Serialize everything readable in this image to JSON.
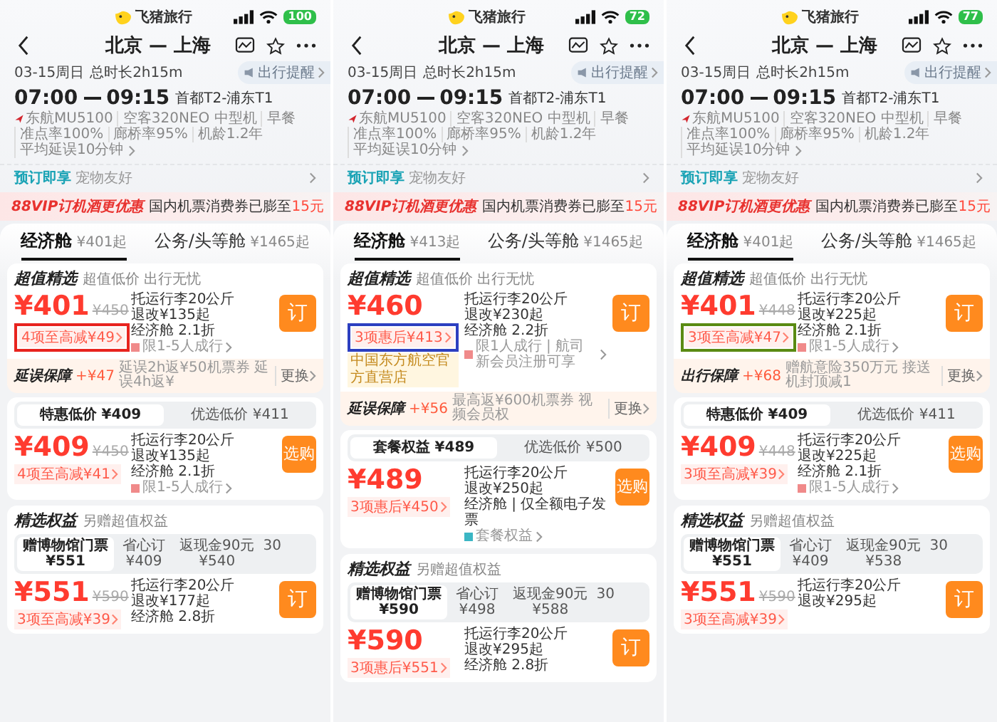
{
  "phones": [
    {
      "status": {
        "app": "飞猪旅行",
        "battery": "100"
      },
      "nav": {
        "title": "北京 — 上海"
      },
      "flight": {
        "date": "03-15周日",
        "duration": "总时长2h15m",
        "reminder": "出行提醒",
        "depart": "07:00",
        "arrive": "09:15",
        "airports": "首都T2-浦东T1",
        "specs": [
          "东航MU5100",
          "空客320NEO 中型机",
          "早餐",
          "准点率100%",
          "廊桥率95%",
          "机龄1.2年",
          "平均延误10分钟"
        ]
      },
      "perk": {
        "label": "预订即享",
        "text": "宠物友好"
      },
      "banner": {
        "highlight": "88VIP订机酒更优惠",
        "text": "国内机票消费券已膨至",
        "amount": "15元"
      },
      "cabins": [
        {
          "label": "经济舱",
          "price": "¥401起",
          "selected": true
        },
        {
          "label": "公务/头等舱",
          "price": "¥1465起",
          "selected": false
        }
      ],
      "offers": [
        {
          "title": "超值精选",
          "subtitle": "超值低价 出行无忧",
          "price": "¥401",
          "old_price": "¥450",
          "discount": "4项至高减¥49",
          "frame": {
            "color": "#e8231e"
          },
          "details": [
            "托运行李20公斤",
            "退改¥135起",
            "经济舱 2.1折"
          ],
          "limit": {
            "text": "限1-5人成行",
            "color": "#f08a8a"
          },
          "button": "订",
          "addon": {
            "title": "延误保障",
            "price": "+¥47",
            "text": "延误2h返¥50机票券 延误4h返¥",
            "action": "更换"
          }
        },
        {
          "options": [
            {
              "label": "特惠低价 ¥409",
              "selected": true
            },
            {
              "label": "优选低价 ¥411",
              "selected": false
            }
          ],
          "price": "¥409",
          "old_price": "¥450",
          "discount": "4项至高减¥41",
          "details": [
            "托运行李20公斤",
            "退改¥135起",
            "经济舱 2.1折"
          ],
          "limit": {
            "text": "限1-5人成行",
            "color": "#f08a8a"
          },
          "button": "选购"
        },
        {
          "title": "精选权益",
          "subtitle": "另赠超值权益",
          "options": [
            {
              "label": "赠博物馆门票",
              "price": "¥551",
              "selected": true
            },
            {
              "label": "省心订",
              "price": "¥409",
              "selected": false
            },
            {
              "label": "返现金90元",
              "price": "¥540",
              "selected": false
            },
            {
              "label": "30",
              "selected": false
            }
          ],
          "price": "¥551",
          "old_price": "¥590",
          "discount": "3项至高减¥39",
          "details": [
            "托运行李20公斤",
            "退改¥177起",
            "经济舱 2.8折"
          ],
          "button": "订"
        }
      ]
    },
    {
      "status": {
        "app": "飞猪旅行",
        "battery": "72"
      },
      "nav": {
        "title": "北京 — 上海"
      },
      "flight": {
        "date": "03-15周日",
        "duration": "总时长2h15m",
        "reminder": "出行提醒",
        "depart": "07:00",
        "arrive": "09:15",
        "airports": "首都T2-浦东T1",
        "specs": [
          "东航MU5100",
          "空客320NEO 中型机",
          "早餐",
          "准点率100%",
          "廊桥率95%",
          "机龄1.2年",
          "平均延误10分钟"
        ]
      },
      "perk": {
        "label": "预订即享",
        "text": "宠物友好"
      },
      "banner": {
        "highlight": "88VIP订机酒更优惠",
        "text": "国内机票消费券已膨至",
        "amount": "15元"
      },
      "cabins": [
        {
          "label": "经济舱",
          "price": "¥413起",
          "selected": true
        },
        {
          "label": "公务/头等舱",
          "price": "¥1465起",
          "selected": false
        }
      ],
      "offers": [
        {
          "title": "超值精选",
          "subtitle": "超值低价 出行无忧",
          "price": "¥460",
          "discount": "3项惠后¥413",
          "frame": {
            "color": "#2c3fc0"
          },
          "badge": "中国东方航空官方直营店",
          "details": [
            "托运行李20公斤",
            "退改¥230起",
            "经济舱 2.2折"
          ],
          "limit": {
            "text": "限1人成行 | 航司新会员注册可享",
            "color": "#f08a8a"
          },
          "button": "订",
          "addon": {
            "title": "延误保障",
            "price": "+¥56",
            "text": "最高返¥600机票券 视频会员权",
            "action": "更换"
          }
        },
        {
          "options": [
            {
              "label": "套餐权益 ¥489",
              "selected": true
            },
            {
              "label": "优选低价 ¥500",
              "selected": false
            }
          ],
          "price": "¥489",
          "discount": "3项惠后¥450",
          "details": [
            "托运行李20公斤",
            "退改¥250起",
            "经济舱 | 仅全额电子发票"
          ],
          "limit": {
            "text": "套餐权益",
            "color": "#3bb6c4"
          },
          "button": "选购"
        },
        {
          "title": "精选权益",
          "subtitle": "另赠超值权益",
          "options": [
            {
              "label": "赠博物馆门票",
              "price": "¥590",
              "selected": true
            },
            {
              "label": "省心订",
              "price": "¥498",
              "selected": false
            },
            {
              "label": "返现金90元",
              "price": "¥588",
              "selected": false
            },
            {
              "label": "30",
              "selected": false
            }
          ],
          "price": "¥590",
          "discount": "3项惠后¥551",
          "details": [
            "托运行李20公斤",
            "退改¥295起",
            "经济舱 2.8折"
          ],
          "button": "订"
        }
      ]
    },
    {
      "status": {
        "app": "飞猪旅行",
        "battery": "77"
      },
      "nav": {
        "title": "北京 — 上海"
      },
      "flight": {
        "date": "03-15周日",
        "duration": "总时长2h15m",
        "reminder": "出行提醒",
        "depart": "07:00",
        "arrive": "09:15",
        "airports": "首都T2-浦东T1",
        "specs": [
          "东航MU5100",
          "空客320NEO 中型机",
          "早餐",
          "准点率100%",
          "廊桥率95%",
          "机龄1.2年",
          "平均延误10分钟"
        ]
      },
      "perk": {
        "label": "预订即享",
        "text": "宠物友好"
      },
      "banner": {
        "highlight": "88VIP订机酒更优惠",
        "text": "国内机票消费券已膨至",
        "amount": "15元"
      },
      "cabins": [
        {
          "label": "经济舱",
          "price": "¥401起",
          "selected": true
        },
        {
          "label": "公务/头等舱",
          "price": "¥1465起",
          "selected": false
        }
      ],
      "offers": [
        {
          "title": "超值精选",
          "subtitle": "超值低价 出行无忧",
          "price": "¥401",
          "old_price": "¥448",
          "discount": "3项至高减¥47",
          "frame": {
            "color": "#5a8a12"
          },
          "details": [
            "托运行李20公斤",
            "退改¥225起",
            "经济舱 2.1折"
          ],
          "limit": {
            "text": "限1-5人成行",
            "color": "#f08a8a"
          },
          "button": "订",
          "addon": {
            "title": "出行保障",
            "price": "+¥68",
            "text": "赠航意险350万元 接送机封顶减1",
            "action": "更换"
          }
        },
        {
          "options": [
            {
              "label": "特惠低价 ¥409",
              "selected": true
            },
            {
              "label": "优选低价 ¥411",
              "selected": false
            }
          ],
          "price": "¥409",
          "old_price": "¥448",
          "discount": "3项至高减¥39",
          "details": [
            "托运行李20公斤",
            "退改¥225起",
            "经济舱 2.1折"
          ],
          "limit": {
            "text": "限1-5人成行",
            "color": "#f08a8a"
          },
          "button": "选购"
        },
        {
          "title": "精选权益",
          "subtitle": "另赠超值权益",
          "options": [
            {
              "label": "赠博物馆门票",
              "price": "¥551",
              "selected": true
            },
            {
              "label": "省心订",
              "price": "¥409",
              "selected": false
            },
            {
              "label": "返现金90元",
              "price": "¥538",
              "selected": false
            },
            {
              "label": "30",
              "selected": false
            }
          ],
          "price": "¥551",
          "old_price": "¥590",
          "discount": "3项至高减¥39",
          "details": [
            "托运行李20公斤",
            "退改¥295起"
          ],
          "button": "订"
        }
      ]
    }
  ]
}
